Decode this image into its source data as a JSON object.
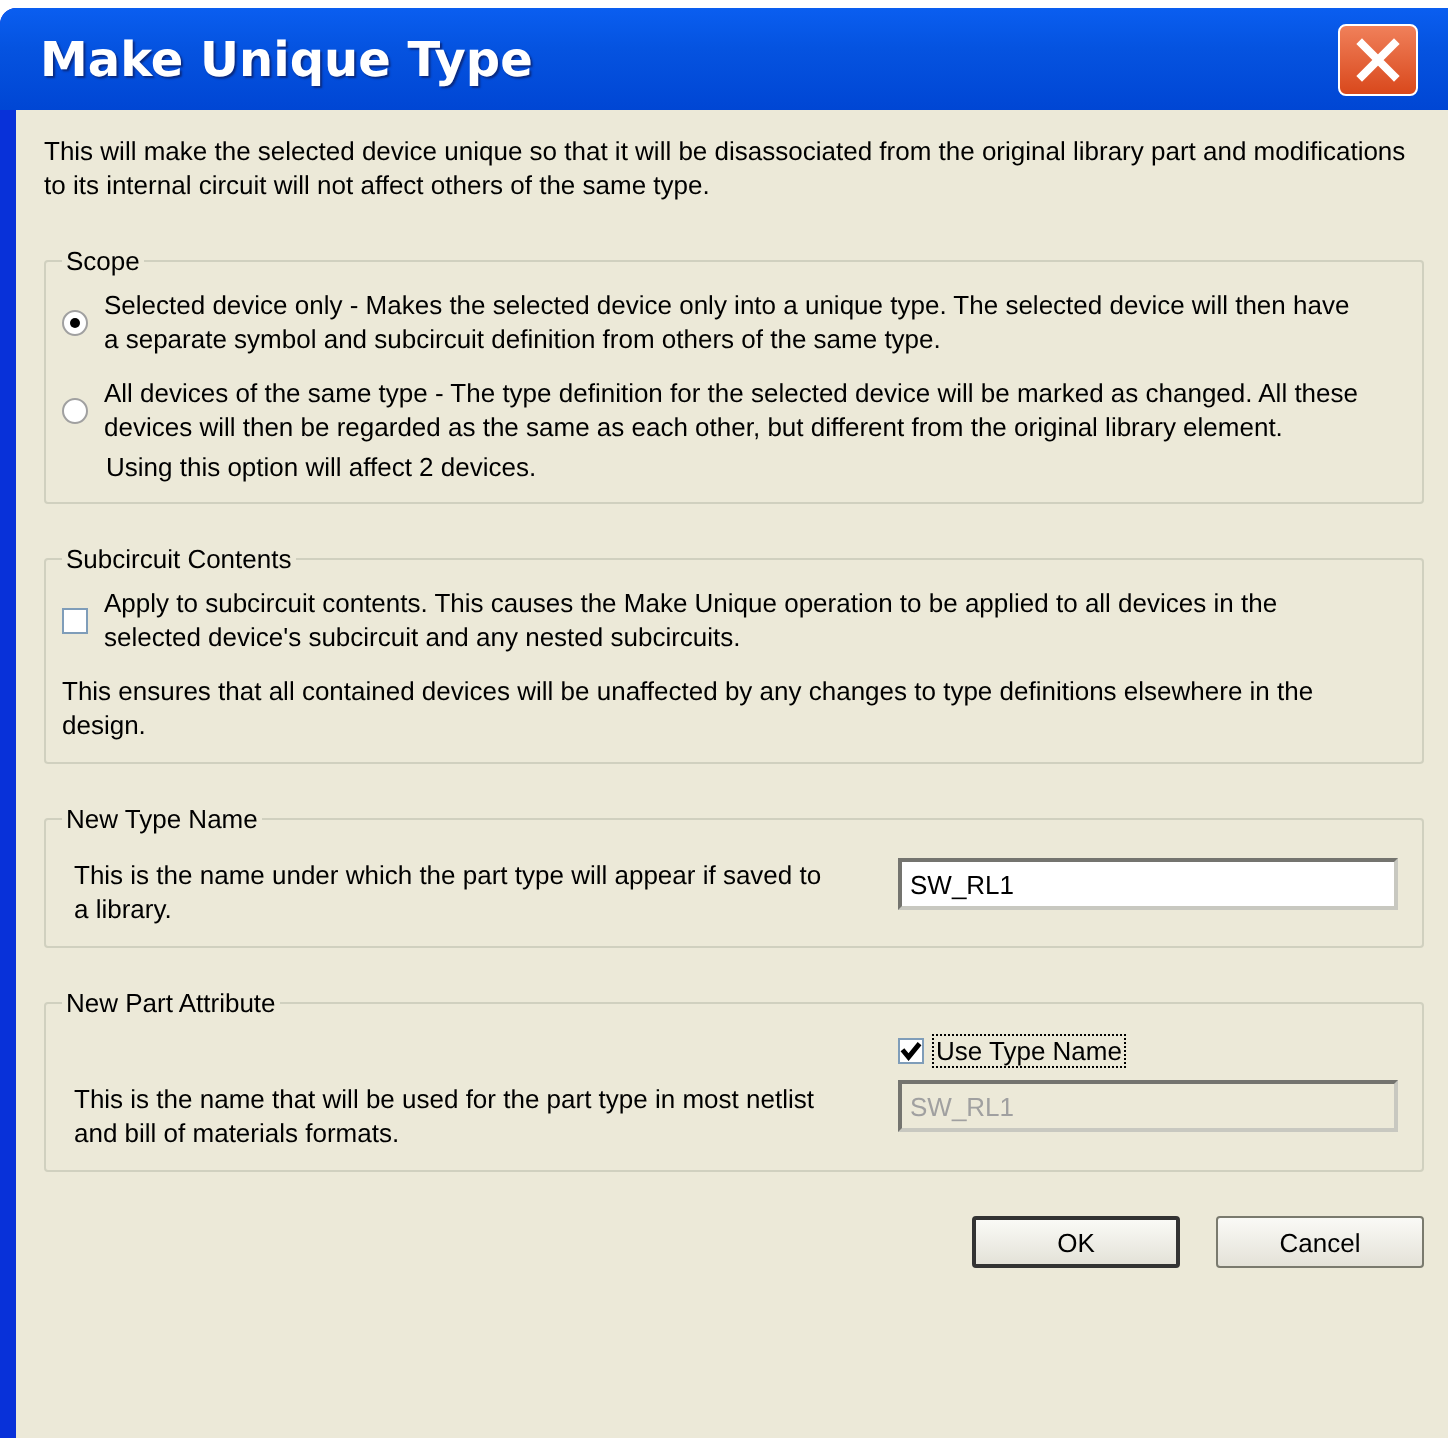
{
  "window": {
    "title": "Make Unique Type"
  },
  "intro": "This will make the selected device unique so that it will be disassociated from the original library part and modifications to its internal circuit will not affect others of the same type.",
  "scope": {
    "legend": "Scope",
    "options": [
      {
        "text": "Selected device only - Makes the selected device only into a unique type.  The selected device will then have a separate symbol and subcircuit definition from others of the same type.",
        "selected": true
      },
      {
        "text": "All devices of the same type - The type definition for the selected device will be marked as changed.  All these devices will then be regarded as the same as each other, but different from the original library element.",
        "selected": false
      }
    ],
    "note": "Using this option will affect 2 devices."
  },
  "subcircuit": {
    "legend": "Subcircuit Contents",
    "checkbox": {
      "label": "Apply to subcircuit contents.  This causes the Make Unique operation to be applied to all devices in the selected device's subcircuit and any nested subcircuits.",
      "checked": false
    },
    "note": "This ensures that all contained devices will be unaffected by any changes to type definitions elsewhere in the design."
  },
  "new_type_name": {
    "legend": "New Type Name",
    "description": "This is the name under which the part type will appear if saved to a library.",
    "value": "SW_RL1"
  },
  "new_part_attribute": {
    "legend": "New Part Attribute",
    "description": "This is the name that will be used for the part type in most netlist and bill of materials formats.",
    "checkbox": {
      "label": "Use Type Name",
      "checked": true
    },
    "value": "SW_RL1",
    "disabled": true
  },
  "buttons": [
    {
      "label": "OK",
      "default": true
    },
    {
      "label": "Cancel",
      "default": false
    }
  ]
}
